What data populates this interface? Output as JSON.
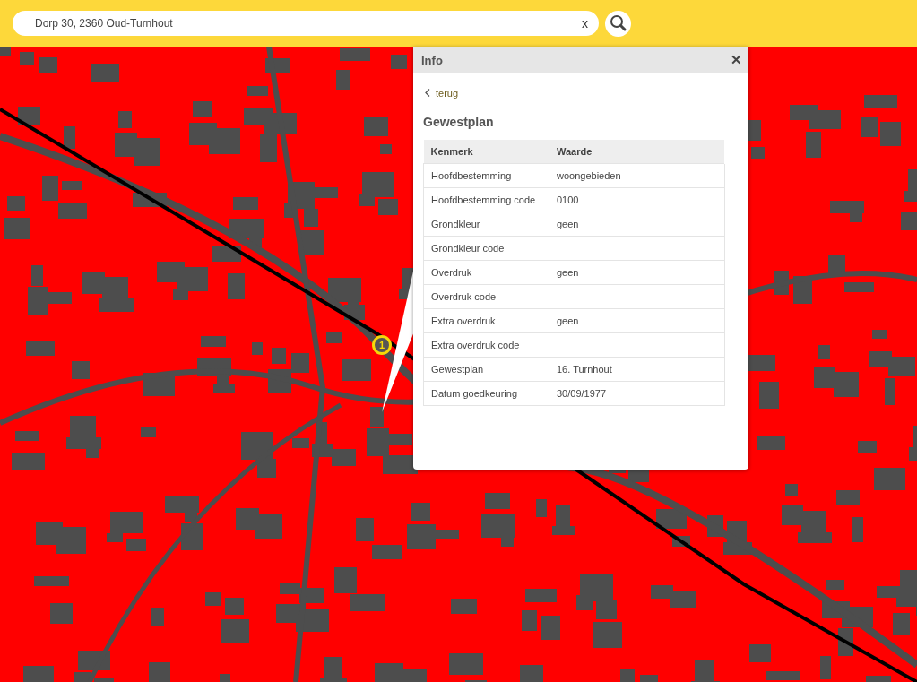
{
  "search": {
    "value": "Dorp 30, 2360 Oud-Turnhout",
    "clear_label": "x"
  },
  "map": {
    "marker_label": "1"
  },
  "info_panel": {
    "title": "Info",
    "close_label": "✕",
    "back_link": "terug",
    "heading": "Gewestplan",
    "table": {
      "columns": [
        "Kenmerk",
        "Waarde"
      ],
      "rows": [
        [
          "Hoofdbestemming",
          "woongebieden"
        ],
        [
          "Hoofdbestemming code",
          "0100"
        ],
        [
          "Grondkleur",
          "geen"
        ],
        [
          "Grondkleur code",
          ""
        ],
        [
          "Overdruk",
          "geen"
        ],
        [
          "Overdruk code",
          ""
        ],
        [
          "Extra overdruk",
          "geen"
        ],
        [
          "Extra overdruk code",
          ""
        ],
        [
          "Gewestplan",
          "16. Turnhout"
        ],
        [
          "Datum goedkeuring",
          "30/09/1977"
        ]
      ]
    }
  }
}
